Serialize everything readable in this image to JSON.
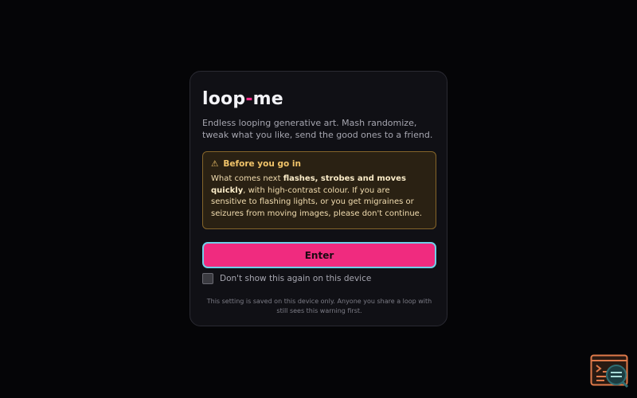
{
  "app": {
    "title_part1": "loop",
    "title_dash": "-",
    "title_part2": "me"
  },
  "intro": {
    "text": "Endless looping generative art. Mash randomize, tweak what you like, send the good ones to a friend."
  },
  "warning": {
    "icon": "⚠",
    "heading": "Before you go in",
    "text_before": "What comes next ",
    "text_bold": "flashes, strobes and moves quickly",
    "text_after": ", with high-contrast colour. If you are sensitive to flashing lights, or you get migraines or seizures from moving images, please don't continue."
  },
  "enter_button": {
    "label": "Enter"
  },
  "dont_show": {
    "label": "Don't show this again on this device",
    "checked": false
  },
  "footnote": {
    "text": "This setting is saved on this device only. Anyone you share a loop with still sees this warning first."
  },
  "colors": {
    "accent": "#f02b7f",
    "focus_ring": "#6fd0e8",
    "warning_border": "#85652a",
    "warning_text": "#f1c46a"
  },
  "icons": {
    "corner_widget": "terminal-search-icon"
  }
}
